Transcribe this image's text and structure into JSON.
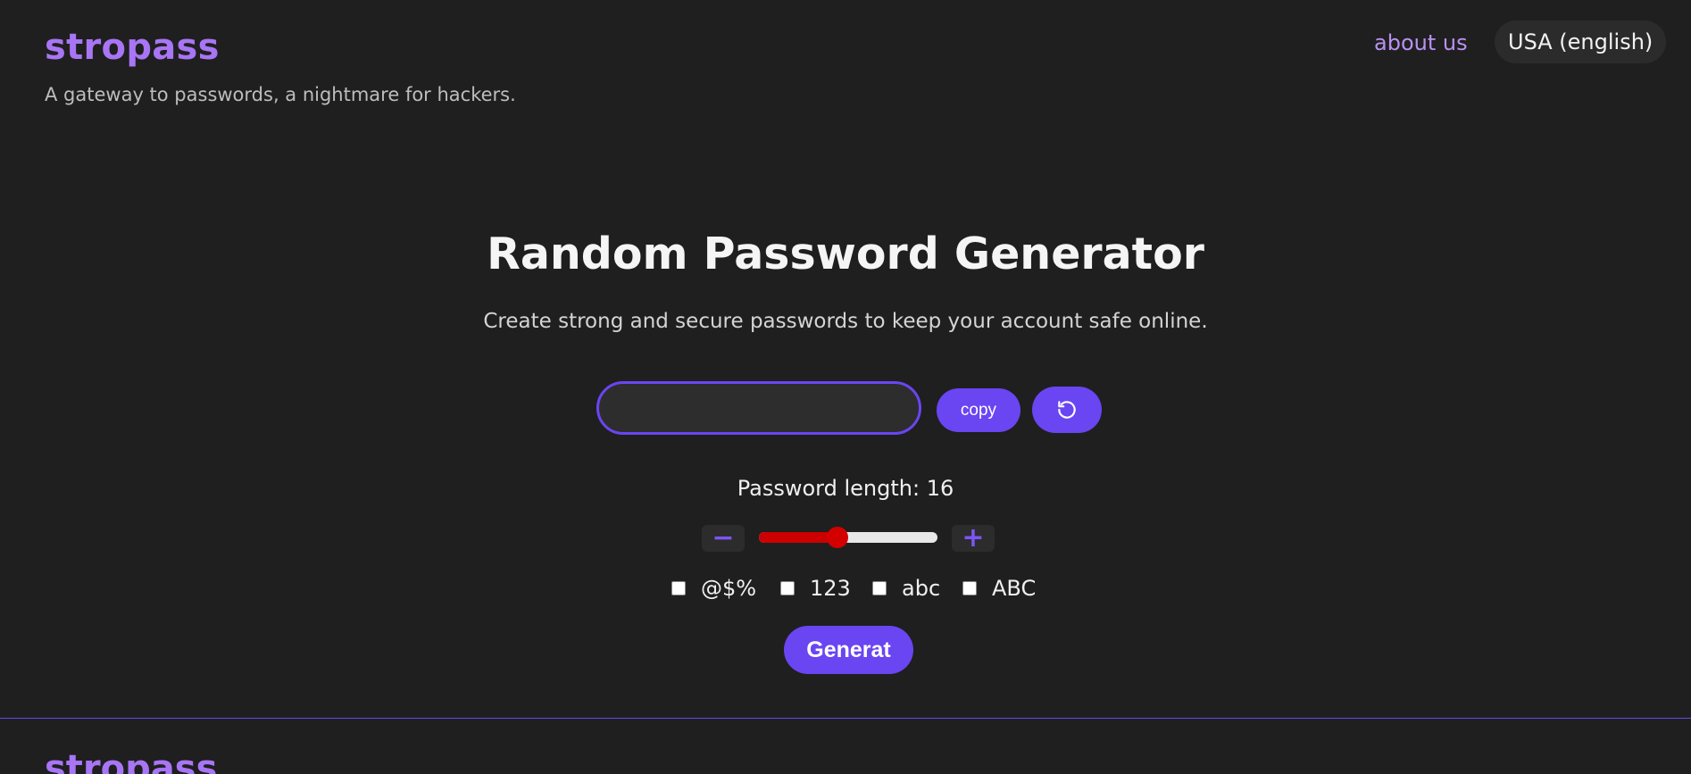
{
  "header": {
    "brand": "stropass",
    "tagline": "A gateway to passwords, a nightmare for hackers.",
    "about_link": "about us",
    "language": "USA (english)"
  },
  "main": {
    "title": "Random Password Generator",
    "subtitle": "Create strong and secure passwords to keep your account safe online.",
    "password_value": "",
    "copy_label": "copy",
    "refresh_icon": "refresh-icon",
    "length_label": "Password length: 16",
    "length_value": 16,
    "slider_fraction": 0.44,
    "minus_label": "−",
    "plus_label": "+",
    "options": [
      {
        "label": "@$%",
        "checked": false
      },
      {
        "label": "123",
        "checked": false
      },
      {
        "label": "abc",
        "checked": false
      },
      {
        "label": "ABC",
        "checked": false
      }
    ],
    "generate_label": "Generat"
  },
  "footer": {
    "brand": "stropass"
  },
  "colors": {
    "accent": "#6a45f2",
    "brand": "#a875f5",
    "slider_fill": "#cc0000",
    "background": "#1f1f1f"
  }
}
